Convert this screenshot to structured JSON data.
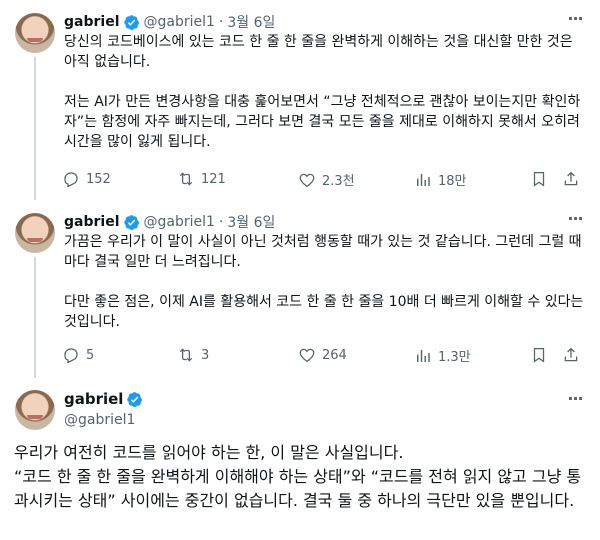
{
  "tweets": [
    {
      "name": "gabriel",
      "handle": "@gabriel1",
      "dot": "·",
      "date": "3월 6일",
      "text": "당신의 코드베이스에 있는 코드 한 줄 한 줄을 완벽하게 이해하는 것을 대신할 만한 것은 아직 없습니다.\n\n저는 AI가 만든 변경사항을 대충 훑어보면서 “그냥 전체적으로 괜찮아 보이는지만 확인하자”는 함정에 자주 빠지는데, 그러다 보면 결국 모든 줄을 제대로 이해하지 못해서 오히려 시간을 많이 잃게 됩니다.",
      "replies": "152",
      "reposts": "121",
      "likes": "2.3천",
      "views": "18만"
    },
    {
      "name": "gabriel",
      "handle": "@gabriel1",
      "dot": "·",
      "date": "3월 6일",
      "text": "가끔은 우리가 이 말이 사실이 아닌 것처럼 행동할 때가 있는 것 같습니다. 그런데 그럴 때마다 결국 일만 더 느려집니다.\n\n다만 좋은 점은, 이제 AI를 활용해서 코드 한 줄 한 줄을 10배 더 빠르게 이해할 수 있다는 것입니다.",
      "replies": "5",
      "reposts": "3",
      "likes": "264",
      "views": "1.3만"
    }
  ],
  "main": {
    "name": "gabriel",
    "handle": "@gabriel1",
    "text": "우리가 여전히 코드를 읽어야 하는 한, 이 말은 사실입니다.\n“코드 한 줄 한 줄을 완벽하게 이해해야 하는 상태”와 “코드를 전혀 읽지 않고 그냥 통과시키는 상태” 사이에는 중간이 없습니다. 결국 둘 중 하나의 극단만 있을 뿐입니다."
  },
  "more_label": "···",
  "colors": {
    "verified": "#1d9bf0",
    "muted": "#536471",
    "text": "#0f1419"
  },
  "icons": [
    "verified-badge-icon",
    "reply-icon",
    "repost-icon",
    "like-icon",
    "views-icon",
    "bookmark-icon",
    "share-icon",
    "more-icon"
  ]
}
